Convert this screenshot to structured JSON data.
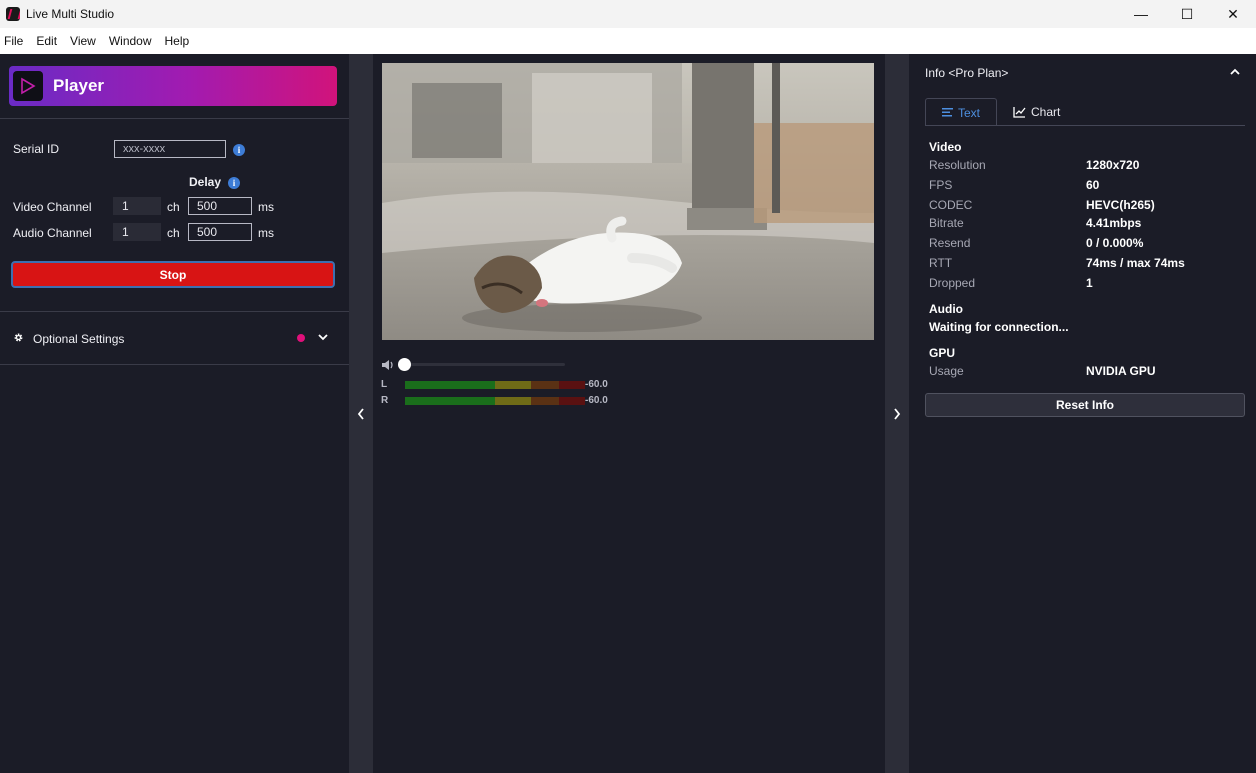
{
  "window": {
    "title": "Live Multi Studio",
    "minimize": "—",
    "maximize": "☐",
    "close": "✕"
  },
  "menu": [
    "File",
    "Edit",
    "View",
    "Window",
    "Help"
  ],
  "left": {
    "banner_title": "Player",
    "serial_label": "Serial ID",
    "serial_value": "xxx-xxxx",
    "delay_label": "Delay",
    "video_channel_label": "Video Channel",
    "video_channel_value": "1",
    "video_delay_value": "500",
    "audio_channel_label": "Audio Channel",
    "audio_channel_value": "1",
    "audio_delay_value": "500",
    "ch_unit": "ch",
    "ms_unit": "ms",
    "stop_label": "Stop",
    "optional_settings_label": "Optional Settings"
  },
  "center": {
    "volume_level": 0.0,
    "meters": [
      {
        "channel": "L",
        "value": "-60.0"
      },
      {
        "channel": "R",
        "value": "-60.0"
      }
    ]
  },
  "right": {
    "header": "Info <Pro Plan>",
    "tabs": [
      {
        "label": "Text",
        "active": true
      },
      {
        "label": "Chart",
        "active": false
      }
    ],
    "video_heading": "Video",
    "video_rows": [
      {
        "key": "Resolution",
        "value": "1280x720"
      },
      {
        "key": "FPS",
        "value": "60"
      },
      {
        "key": "CODEC",
        "value": "HEVC(h265)"
      },
      {
        "key": "Bitrate",
        "value": "4.41mbps"
      },
      {
        "key": "Resend",
        "value": "0 / 0.000%"
      },
      {
        "key": "RTT",
        "value": "74ms / max 74ms"
      },
      {
        "key": "Dropped",
        "value": "1"
      }
    ],
    "audio_heading": "Audio",
    "audio_status": "Waiting for connection...",
    "gpu_heading": "GPU",
    "gpu_rows": [
      {
        "key": "Usage",
        "value": "NVIDIA GPU"
      }
    ],
    "reset_label": "Reset Info"
  },
  "colors": {
    "accent_blue": "#4d8fe0",
    "stop_red": "#d81414",
    "status_pink": "#e0107a"
  }
}
